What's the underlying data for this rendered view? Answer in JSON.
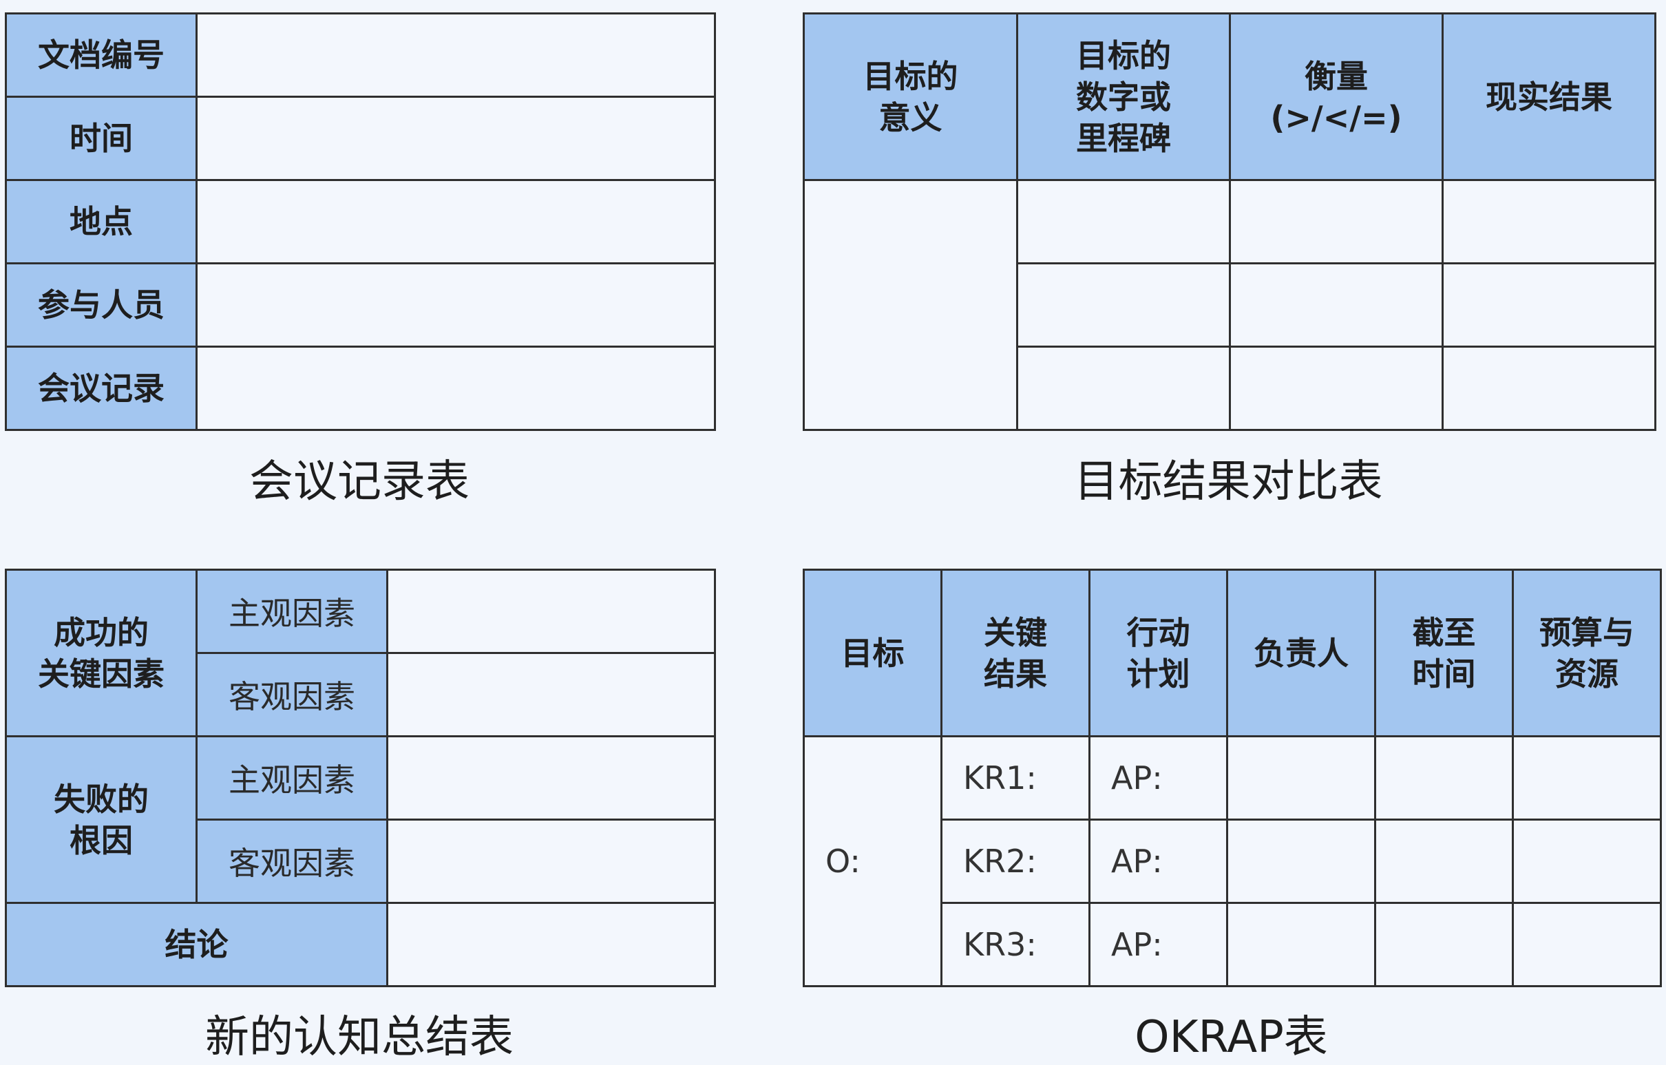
{
  "meeting_table": {
    "rows": [
      "文档编号",
      "时间",
      "地点",
      "参与人员",
      "会议记录"
    ],
    "caption": "会议记录表"
  },
  "goal_table": {
    "headers": [
      [
        "目标的",
        "意义"
      ],
      [
        "目标的",
        "数字或",
        "里程碑"
      ],
      [
        "衡量",
        "(>/</=)"
      ],
      [
        "现实结果"
      ]
    ],
    "caption": "目标结果对比表"
  },
  "cognition_table": {
    "success_label": [
      "成功的",
      "关键因素"
    ],
    "failure_label": [
      "失败的",
      "根因"
    ],
    "subjective": "主观因素",
    "objective": "客观因素",
    "conclusion": "结论",
    "caption": "新的认知总结表"
  },
  "okrap_table": {
    "headers": [
      [
        "目标"
      ],
      [
        "关键",
        "结果"
      ],
      [
        "行动",
        "计划"
      ],
      [
        "负责人"
      ],
      [
        "截至",
        "时间"
      ],
      [
        "预算与",
        "资源"
      ]
    ],
    "objective_label": "O:",
    "kr_labels": [
      "KR1:",
      "KR2:",
      "KR3:"
    ],
    "ap_label": "AP:",
    "caption": "OKRAP表"
  }
}
